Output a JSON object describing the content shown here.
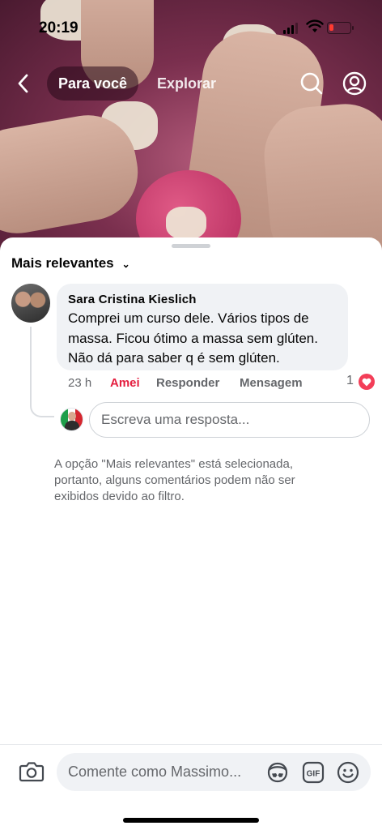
{
  "status_bar": {
    "time": "20:19",
    "battery_level": 0.2,
    "battery_color": "#ff3b30"
  },
  "nav": {
    "back_icon": "chevron-left-icon",
    "tabs": [
      {
        "label": "Para você",
        "active": true
      },
      {
        "label": "Explorar",
        "active": false
      }
    ],
    "search_icon": "search-icon",
    "profile_icon": "profile-icon"
  },
  "comments_sheet": {
    "sort_label": "Mais relevantes",
    "sort_icon": "chevron-down-icon",
    "comment": {
      "author": "Sara Cristina Kieslich",
      "text": "Comprei um curso dele. Vários tipos de massa. Ficou ótimo a massa sem glúten. Não dá para saber q é sem glúten.",
      "time": "23 h",
      "love_label": "Amei",
      "reply_label": "Responder",
      "message_label": "Mensagem",
      "reaction_count": "1",
      "reaction_icon": "heart-icon"
    },
    "reply_placeholder": "Escreva uma resposta...",
    "filter_note": "A opção \"Mais relevantes\" está selecionada, portanto, alguns comentários podem não ser exibidos devido ao filtro."
  },
  "composer": {
    "camera_icon": "camera-icon",
    "placeholder": "Comente como Massimo...",
    "icons": [
      "avatar-sticker-icon",
      "gif-icon",
      "emoji-icon"
    ]
  },
  "colors": {
    "accent_love": "#e41e3f",
    "bubble_bg": "#f0f2f5",
    "muted_text": "#65676b"
  }
}
